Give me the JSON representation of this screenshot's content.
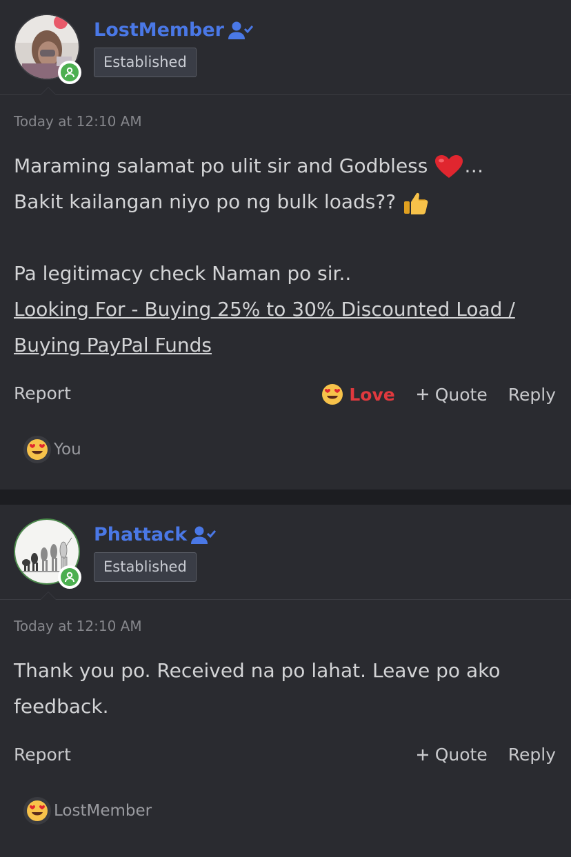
{
  "posts": [
    {
      "username": "LostMember",
      "badge": "Established",
      "timestamp": "Today at 12:10 AM",
      "lines": [
        "Maraming salamat po ulit sir and Godbless",
        "…",
        "Bakit kailangan niyo po ng bulk loads??",
        "Pa legitimacy check Naman po sir..",
        "Looking For - Buying 25% to 30% Discounted Load /",
        "Buying PayPal Funds"
      ],
      "actions": {
        "report": "Report",
        "love": "Love",
        "quote": "Quote",
        "reply": "Reply"
      },
      "reactions_by": "You"
    },
    {
      "username": "Phattack",
      "badge": "Established",
      "timestamp": "Today at 12:10 AM",
      "lines": [
        "Thank you po. Received na po lahat. Leave po ako",
        "feedback."
      ],
      "actions": {
        "report": "Report",
        "quote": "Quote",
        "reply": "Reply"
      },
      "reactions_by": "LostMember"
    }
  ],
  "colors": {
    "background": "#1c1d21",
    "post_bg": "#2a2b30",
    "username": "#4a78e6",
    "love": "#e0393e",
    "online": "#4caf50"
  },
  "icons": [
    "user-check-icon",
    "heart-icon",
    "thumbs-up-icon",
    "heart-eyes-emoji-icon",
    "plus-icon",
    "online-status-icon"
  ]
}
